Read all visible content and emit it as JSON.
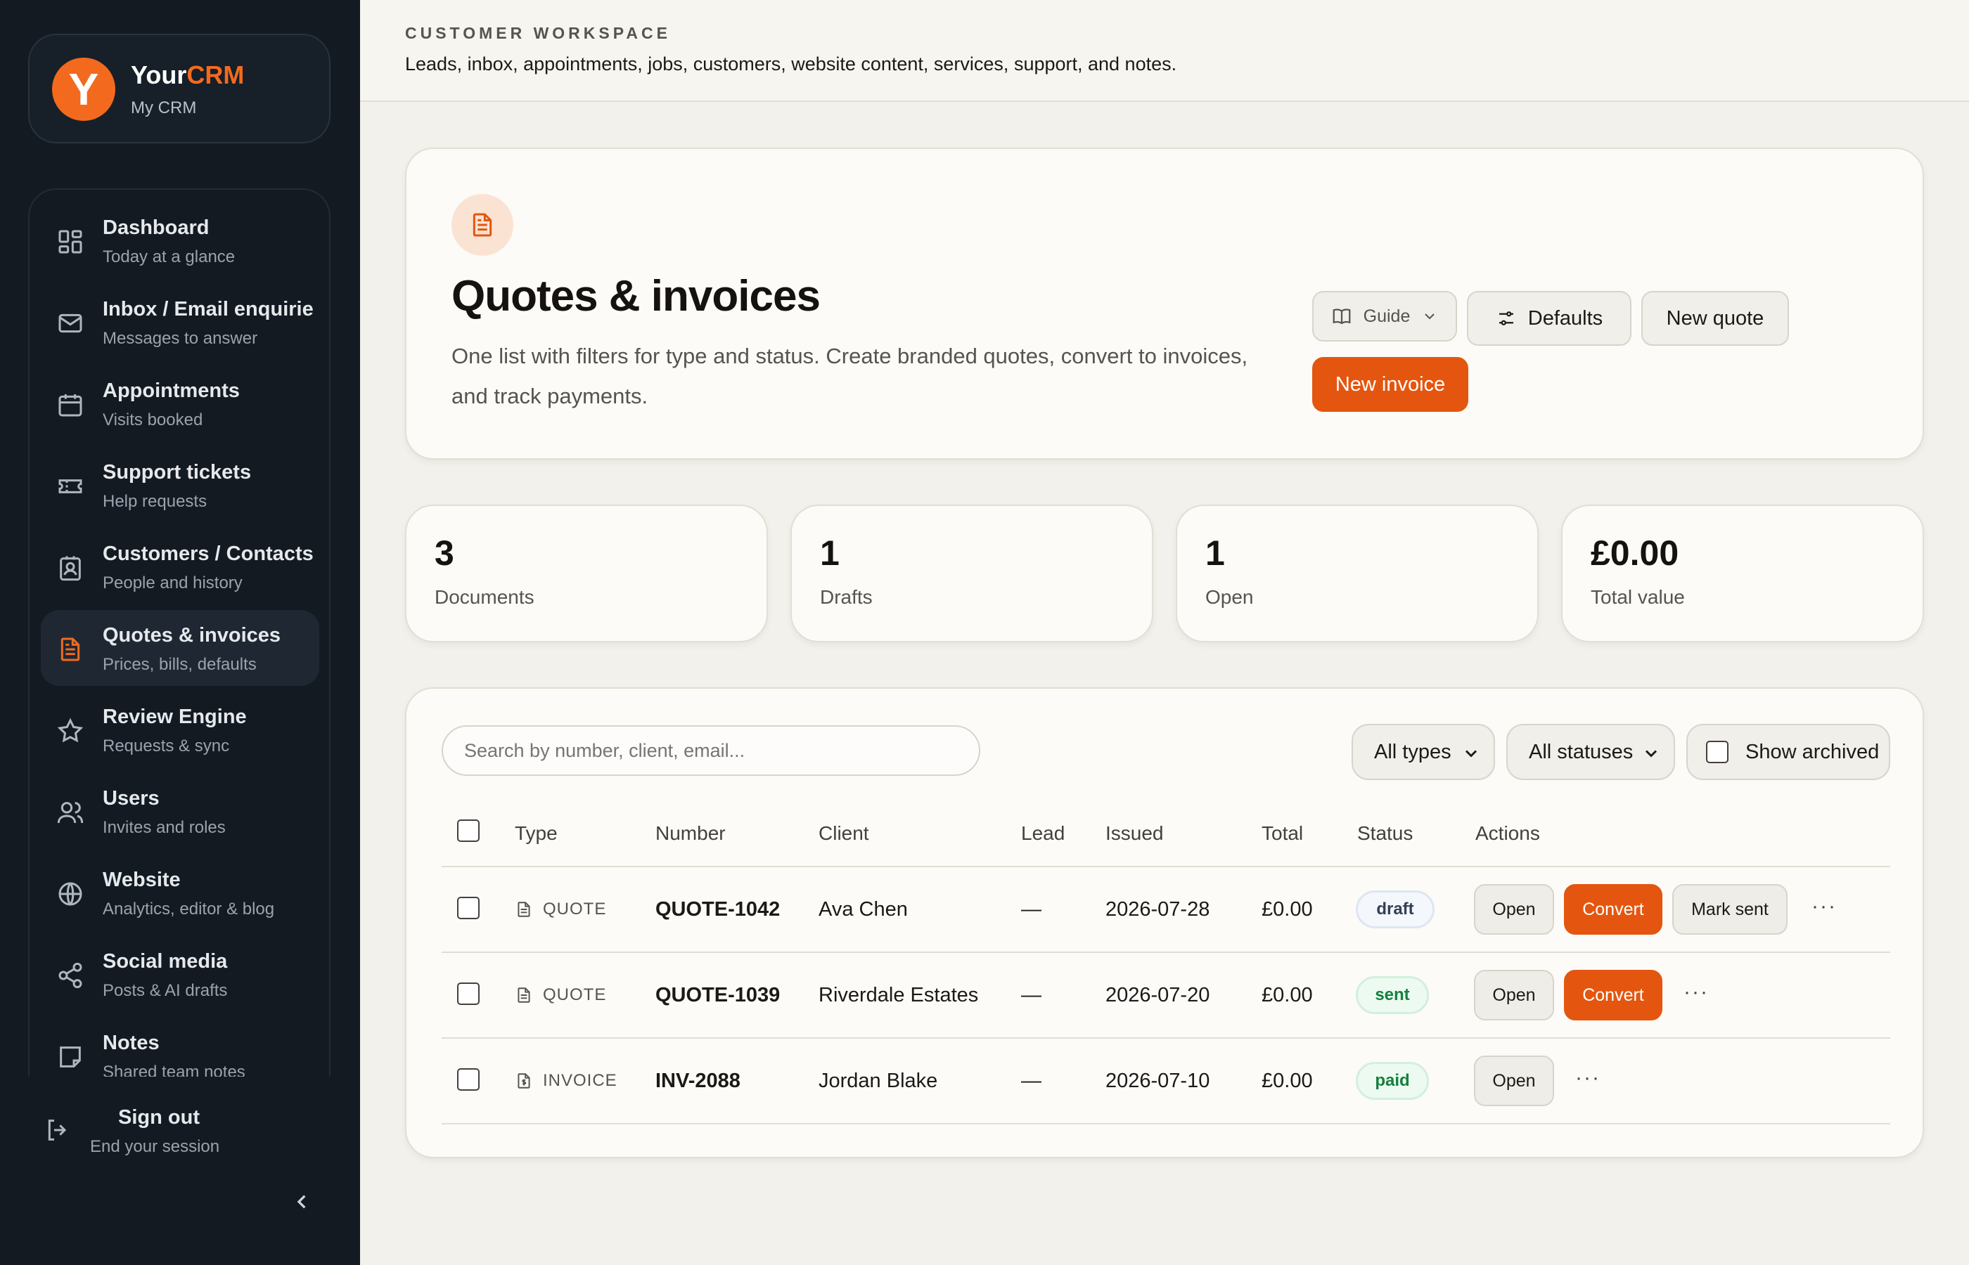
{
  "brand": {
    "logo_letter": "Y",
    "name_part1": "Your",
    "name_part2": "CRM",
    "subtitle": "My CRM"
  },
  "sidebar": {
    "items": [
      {
        "title": "Dashboard",
        "subtitle": "Today at a glance",
        "icon": "dashboard-icon"
      },
      {
        "title": "Inbox / Email enquiries",
        "subtitle": "Messages to answer",
        "icon": "mail-icon"
      },
      {
        "title": "Appointments",
        "subtitle": "Visits booked",
        "icon": "calendar-icon"
      },
      {
        "title": "Support tickets",
        "subtitle": "Help requests",
        "icon": "ticket-icon"
      },
      {
        "title": "Customers / Contacts",
        "subtitle": "People and history",
        "icon": "contact-icon"
      },
      {
        "title": "Quotes & invoices",
        "subtitle": "Prices, bills, defaults",
        "icon": "document-icon",
        "active": true
      },
      {
        "title": "Review Engine",
        "subtitle": "Requests & sync",
        "icon": "star-icon"
      },
      {
        "title": "Users",
        "subtitle": "Invites and roles",
        "icon": "users-icon"
      },
      {
        "title": "Website",
        "subtitle": "Analytics, editor & blog",
        "icon": "globe-icon"
      },
      {
        "title": "Social media",
        "subtitle": "Posts & AI drafts",
        "icon": "share-icon"
      },
      {
        "title": "Notes",
        "subtitle": "Shared team notes",
        "icon": "note-icon"
      }
    ],
    "signout": {
      "title": "Sign out",
      "subtitle": "End your session"
    }
  },
  "header": {
    "eyebrow": "CUSTOMER WORKSPACE",
    "tagline": "Leads, inbox, appointments, jobs, customers, website content, services, support, and notes."
  },
  "hero": {
    "title": "Quotes & invoices",
    "description": "One list with filters for type and status. Create branded quotes, convert to invoices, and track payments.",
    "buttons": {
      "guide": "Guide",
      "defaults": "Defaults",
      "new_quote": "New quote",
      "new_invoice": "New invoice"
    }
  },
  "stats": [
    {
      "value": "3",
      "label": "Documents"
    },
    {
      "value": "1",
      "label": "Drafts"
    },
    {
      "value": "1",
      "label": "Open"
    },
    {
      "value": "£0.00",
      "label": "Total value"
    }
  ],
  "filters": {
    "search_placeholder": "Search by number, client, email...",
    "type_select": "All types",
    "status_select": "All statuses",
    "show_archived": "Show archived"
  },
  "table": {
    "columns": [
      "Type",
      "Number",
      "Client",
      "Lead",
      "Issued",
      "Total",
      "Status",
      "Actions"
    ],
    "rows": [
      {
        "type": "QUOTE",
        "number": "QUOTE-1042",
        "client": "Ava Chen",
        "lead": "—",
        "issued": "2026-07-28",
        "total": "£0.00",
        "status": "draft",
        "actions": [
          "Open",
          "Convert",
          "Mark sent"
        ]
      },
      {
        "type": "QUOTE",
        "number": "QUOTE-1039",
        "client": "Riverdale Estates",
        "lead": "—",
        "issued": "2026-07-20",
        "total": "£0.00",
        "status": "sent",
        "actions": [
          "Open",
          "Convert"
        ]
      },
      {
        "type": "INVOICE",
        "number": "INV-2088",
        "client": "Jordan Blake",
        "lead": "—",
        "issued": "2026-07-10",
        "total": "£0.00",
        "status": "paid",
        "actions": [
          "Open"
        ]
      }
    ],
    "more_label": "···"
  },
  "colors": {
    "accent": "#e4560f",
    "sidebar_bg": "#131a22",
    "page_bg": "#f3f1ec"
  }
}
